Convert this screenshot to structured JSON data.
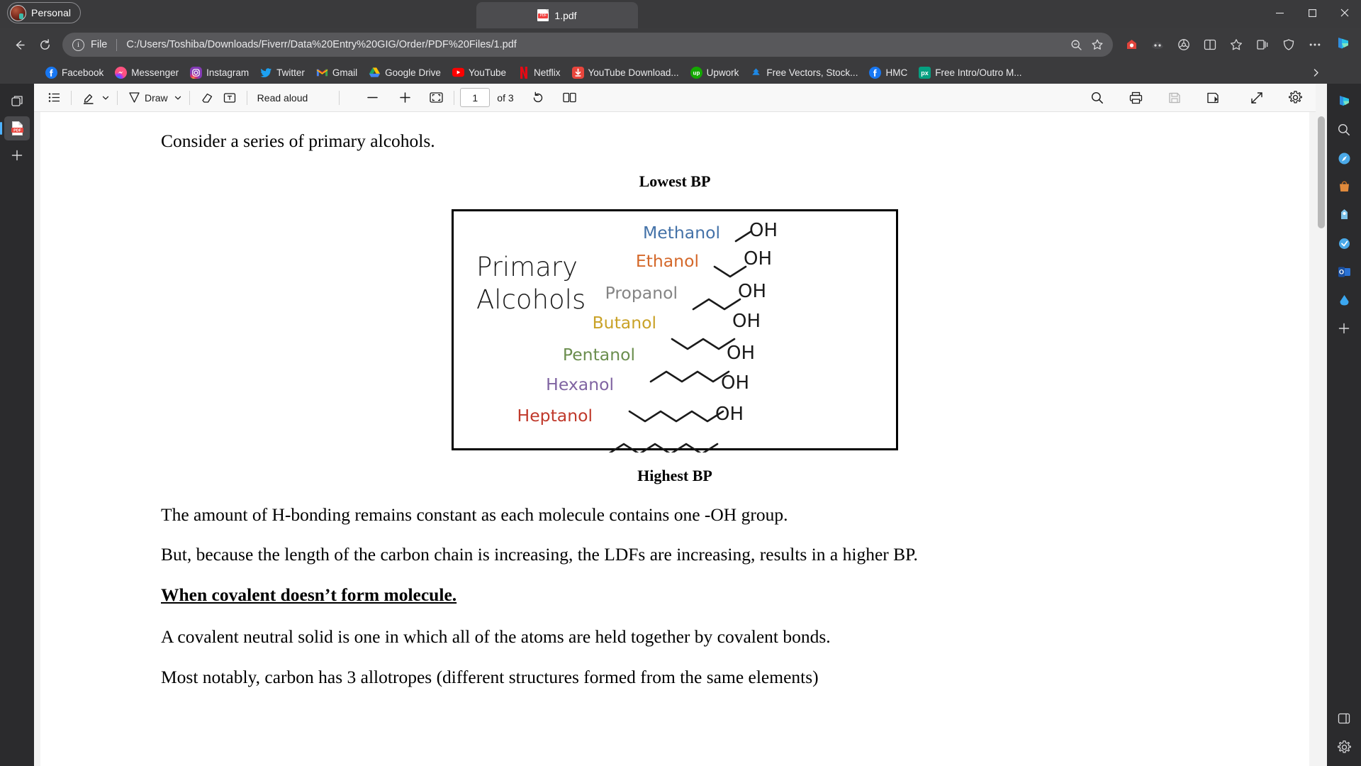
{
  "window": {
    "profile_label": "Personal",
    "minimize_label": "Minimize",
    "maximize_label": "Maximize",
    "close_label": "Close"
  },
  "tab": {
    "title": "1.pdf",
    "favicon_text": "PDF",
    "icon": "pdf-file-icon"
  },
  "address_bar": {
    "scheme_label": "File",
    "url": "C:/Users/Toshiba/Downloads/Fiverr/Data%20Entry%20GIG/Order/PDF%20Files/1.pdf",
    "back_icon": "back-arrow-icon",
    "reload_icon": "reload-icon",
    "info_icon": "info-icon",
    "zoom_icon": "zoom-magnifier-icon",
    "favorite_icon": "star-icon",
    "extensions": [
      {
        "name": "extension-icon-1",
        "color": "#e0443c"
      },
      {
        "name": "extension-icon-2",
        "color": "#6b6b6b"
      },
      {
        "name": "extension-icon-3",
        "color": "#d8d8da"
      },
      {
        "name": "split-screen-icon",
        "color": "#d8d8da"
      },
      {
        "name": "favorites-icon",
        "color": "#d8d8da"
      },
      {
        "name": "collections-icon",
        "color": "#d8d8da"
      },
      {
        "name": "browser-essentials-icon",
        "color": "#d8d8da"
      },
      {
        "name": "settings-more-icon",
        "color": "#d8d8da"
      }
    ],
    "copilot_label": "Copilot"
  },
  "bookmarks": {
    "items": [
      {
        "label": "Facebook",
        "icon": "facebook-icon",
        "color": "#1877f2"
      },
      {
        "label": "Messenger",
        "icon": "messenger-icon",
        "color": "#c43ad6"
      },
      {
        "label": "Instagram",
        "icon": "instagram-icon",
        "color": "#e1306c"
      },
      {
        "label": "Twitter",
        "icon": "twitter-icon",
        "color": "#1da1f2"
      },
      {
        "label": "Gmail",
        "icon": "gmail-icon",
        "color": "#ea4335"
      },
      {
        "label": "Google Drive",
        "icon": "google-drive-icon",
        "color": "#ffc107"
      },
      {
        "label": "YouTube",
        "icon": "youtube-icon",
        "color": "#ff0000"
      },
      {
        "label": "Netflix",
        "icon": "netflix-icon",
        "color": "#e50914"
      },
      {
        "label": "YouTube Download...",
        "icon": "youtube-download-icon",
        "color": "#e8453c"
      },
      {
        "label": "Upwork",
        "icon": "upwork-icon",
        "color": "#14a800"
      },
      {
        "label": "Free Vectors, Stock...",
        "icon": "vectors-stock-icon",
        "color": "#1e88e5"
      },
      {
        "label": "HMC",
        "icon": "hmc-icon",
        "color": "#1877f2"
      },
      {
        "label": "Free Intro/Outro M...",
        "icon": "pexels-icon",
        "color": "#05a081"
      }
    ],
    "overflow_icon": "chevron-right-icon"
  },
  "left_rail": {
    "items": [
      {
        "name": "tab-actions-icon",
        "active": false
      },
      {
        "name": "pdf-viewer-icon",
        "active": true
      },
      {
        "name": "new-tab-plus-icon",
        "active": false
      }
    ]
  },
  "pdf_toolbar": {
    "toc_icon": "table-of-contents-icon",
    "highlight_icon": "highlight-pen-icon",
    "highlight_chevron": "chevron-down-icon",
    "draw_icon": "draw-pen-icon",
    "draw_label": "Draw",
    "draw_chevron": "chevron-down-icon",
    "erase_icon": "eraser-icon",
    "text_icon": "add-text-icon",
    "read_aloud_label": "Read aloud",
    "zoom_out_icon": "zoom-out-icon",
    "zoom_in_icon": "zoom-in-icon",
    "fit_page_icon": "fit-to-page-icon",
    "page_number": "1",
    "page_total": "of 3",
    "rotate_icon": "rotate-icon",
    "page_view_icon": "page-layout-icon",
    "search_icon": "search-icon",
    "print_icon": "print-icon",
    "save_icon": "save-icon",
    "save_as_icon": "save-as-icon",
    "fullscreen_icon": "fullscreen-icon",
    "settings_icon": "settings-gear-icon"
  },
  "document": {
    "intro": "Consider a series of primary alcohols.",
    "lowest_bp": "Lowest BP",
    "highest_bp": "Highest BP",
    "figure": {
      "title_line1": "Primary",
      "title_line2": "Alcohols",
      "oh_label": "OH",
      "molecules": [
        {
          "name": "Methanol",
          "color": "#4472a8",
          "carbons": 1
        },
        {
          "name": "Ethanol",
          "color": "#d4682a",
          "carbons": 2
        },
        {
          "name": "Propanol",
          "color": "#848484",
          "carbons": 3
        },
        {
          "name": "Butanol",
          "color": "#c9a227",
          "carbons": 4
        },
        {
          "name": "Pentanol",
          "color": "#6b8e4e",
          "carbons": 5
        },
        {
          "name": "Hexanol",
          "color": "#8064a2",
          "carbons": 6
        },
        {
          "name": "Heptanol",
          "color": "#c0392b",
          "carbons": 7
        }
      ]
    },
    "para1": "The amount of H-bonding remains constant as each molecule contains one -OH group.",
    "para2": "But, because the length of the carbon chain is increasing, the LDFs are increasing, results in a higher BP.",
    "heading": "When covalent doesn’t form molecule.",
    "para3": "A covalent neutral solid is one in which all of the atoms are held together by covalent bonds.",
    "para4": "Most notably, carbon has 3 allotropes (different structures formed from the same elements)"
  },
  "right_rail": {
    "items": [
      {
        "name": "copilot-icon",
        "color": "#3ba7f0"
      },
      {
        "name": "search-icon",
        "color": "#d8d8da"
      },
      {
        "name": "discover-icon",
        "color": "#4aa9e8"
      },
      {
        "name": "shopping-icon",
        "color": "#e08a3c"
      },
      {
        "name": "games-icon",
        "color": "#7dc2e8"
      },
      {
        "name": "tools-icon",
        "color": "#4aa9e8"
      },
      {
        "name": "outlook-icon",
        "color": "#2a72d4"
      },
      {
        "name": "drop-icon",
        "color": "#3ba7f0"
      },
      {
        "name": "add-tools-icon",
        "color": "#d8d8da"
      }
    ],
    "bottom_items": [
      {
        "name": "sidebar-toggle-icon",
        "color": "#d8d8da"
      },
      {
        "name": "sidebar-settings-icon",
        "color": "#d8d8da"
      }
    ]
  }
}
